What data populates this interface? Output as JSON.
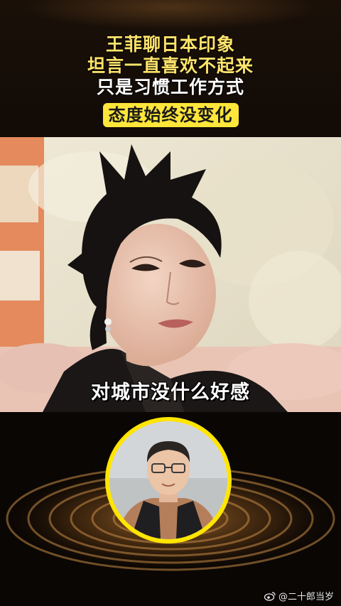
{
  "headline": {
    "line1": "王菲聊日本印象",
    "line2": "坦言一直喜欢不起来",
    "line3": "只是习惯工作方式",
    "badge": "态度始终没变化"
  },
  "video": {
    "subtitle": "对城市没什么好感"
  },
  "watermark": {
    "icon": "weibo-icon",
    "handle": "@二十郎当岁"
  },
  "colors": {
    "headline_yellow": "#ffe46b",
    "badge_background": "#ffe63a",
    "avatar_ring": "#ffe500"
  }
}
